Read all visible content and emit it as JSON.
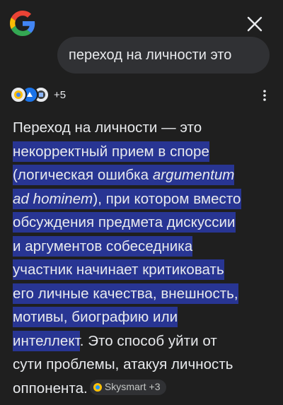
{
  "header": {
    "logo_icon": "google-g-logo-icon",
    "close_icon": "close-icon"
  },
  "query": {
    "text": "переход на личности это"
  },
  "sources": {
    "count_label": "+5",
    "icons": [
      "source-favicon-1",
      "source-favicon-2",
      "source-favicon-3"
    ],
    "menu_icon": "more-vert-icon"
  },
  "answer": {
    "line1": "Переход на личности — это",
    "line2": "некорректный прием в споре",
    "line3a": "(логическая ошибка ",
    "line3b": "argumentum",
    "line4a": "ad hominem",
    "line4b": "), при котором вместо",
    "line5": "обсуждения предмета дискуссии",
    "line6": "и аргументов собеседника",
    "line7": "участник начинает критиковать",
    "line8": "его личные качества, внешность,",
    "line9": "мотивы, биографию или",
    "line10a": "интеллект",
    "line10b": ". Это способ уйти от",
    "line11": "сути проблемы, атакуя личность",
    "line12": "оппонента."
  },
  "source_chip": {
    "label": "Skysmart +3",
    "icon": "skysmart-favicon-icon"
  },
  "colors": {
    "background": "#1f1f1f",
    "bubble": "#303134",
    "highlight": "#283593",
    "text": "#e8eaed"
  }
}
